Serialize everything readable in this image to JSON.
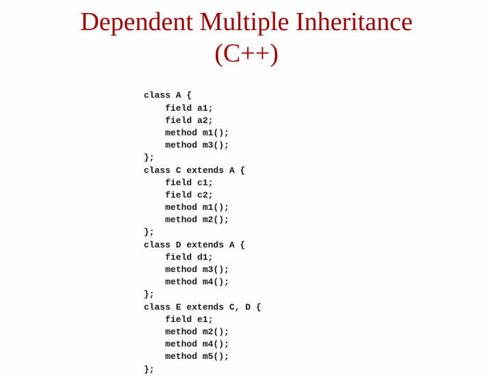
{
  "title_line1": "Dependent Multiple Inheritance",
  "title_line2": "(C++)",
  "code": {
    "classA": {
      "decl": "class A {",
      "l1": "    field a1;",
      "l2": "    field a2;",
      "l3": "    method m1();",
      "l4": "    method m3();",
      "close": "};"
    },
    "classC": {
      "decl": "class C extends A {",
      "l1": "    field c1;",
      "l2": "    field c2;",
      "l3": "    method m1();",
      "l4": "    method m2();",
      "close": "};"
    },
    "classD": {
      "decl": "class D extends A {",
      "l1": "    field d1;",
      "l2": "    method m3();",
      "l3": "    method m4();",
      "close": "};"
    },
    "classE": {
      "decl": "class E extends C, D {",
      "l1": "    field e1;",
      "l2": "    method m2();",
      "l3": "    method m4();",
      "l4": "    method m5();",
      "close": "};"
    }
  }
}
